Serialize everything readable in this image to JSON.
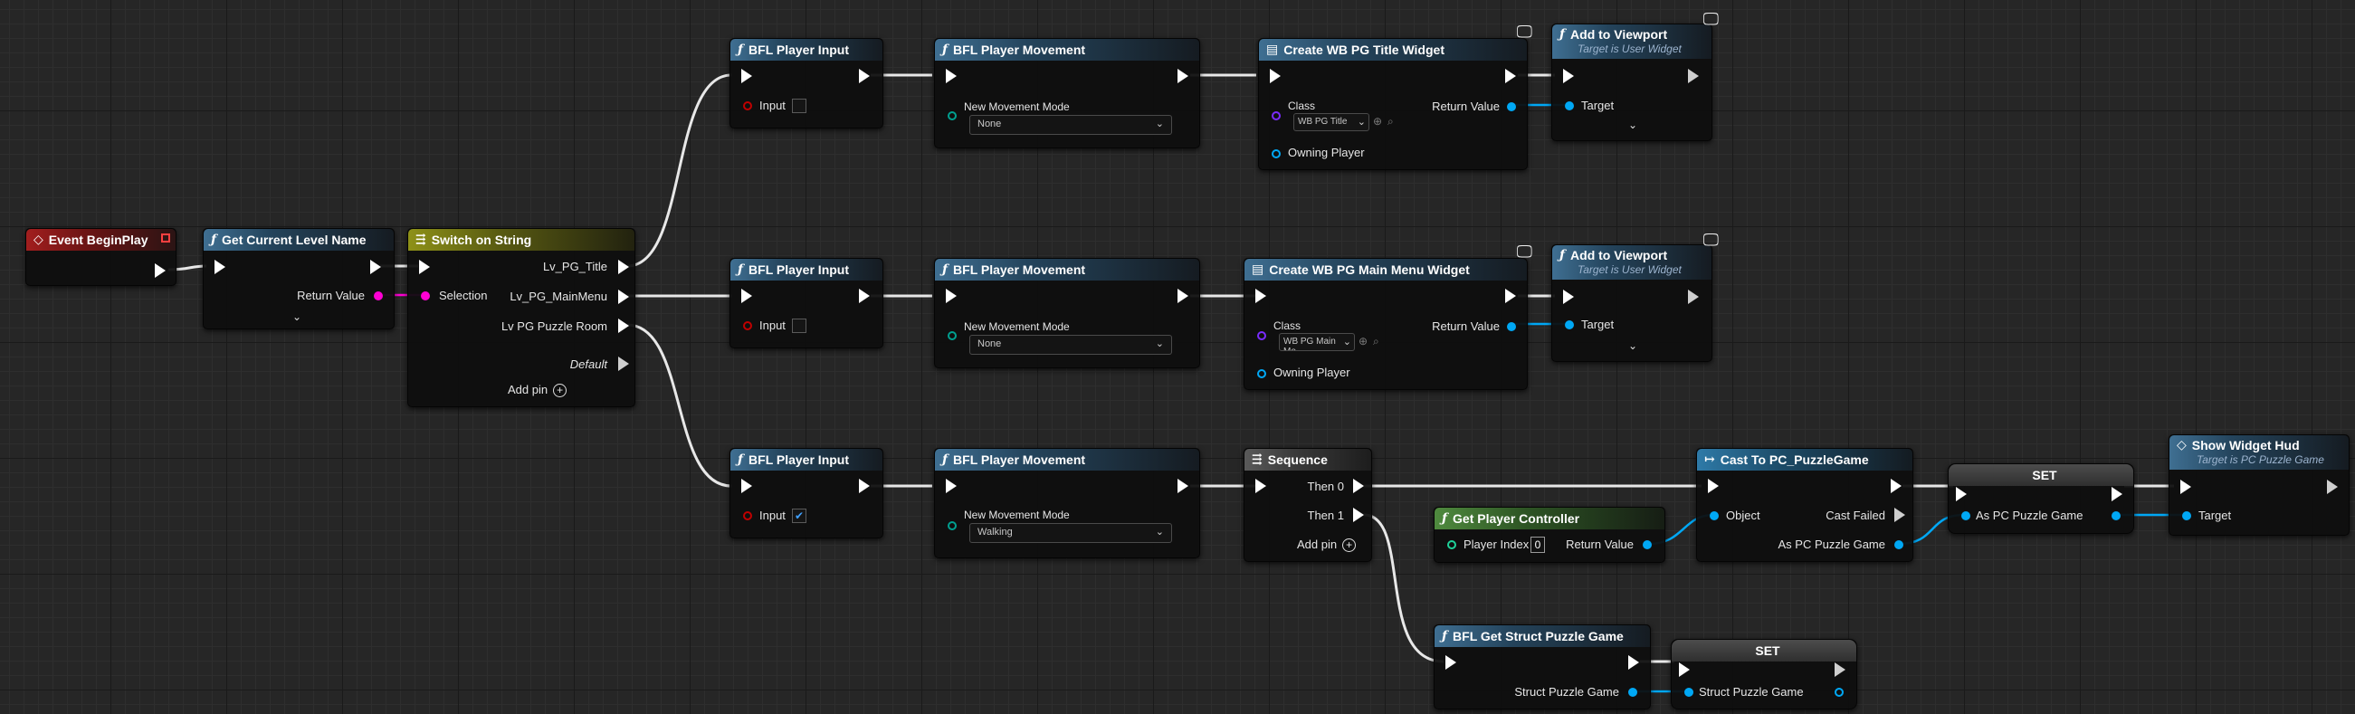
{
  "nodes": {
    "event_begin_play": {
      "title": "Event BeginPlay"
    },
    "get_current_level": {
      "title": "Get Current Level Name",
      "return_label": "Return Value"
    },
    "switch_on_string": {
      "title": "Switch on String",
      "input_label": "Selection",
      "outputs": [
        "Lv_PG_Title",
        "Lv_PG_MainMenu",
        "Lv PG Puzzle Room",
        "Default"
      ],
      "add_pin": "Add pin"
    },
    "row1": {
      "player_input": {
        "title": "BFL Player Input",
        "input_label": "Input",
        "checked": ""
      },
      "player_movement": {
        "title": "BFL Player Movement",
        "mode_label": "New Movement Mode",
        "mode_value": "None"
      },
      "create_widget": {
        "title": "Create WB PG Title Widget",
        "class_label": "Class",
        "class_value": "WB PG Title",
        "return_label": "Return Value",
        "owning_label": "Owning Player"
      },
      "add_viewport": {
        "title": "Add to Viewport",
        "subtitle": "Target is User Widget",
        "target_label": "Target"
      }
    },
    "row2": {
      "player_input": {
        "title": "BFL Player Input",
        "input_label": "Input",
        "checked": ""
      },
      "player_movement": {
        "title": "BFL Player Movement",
        "mode_label": "New Movement Mode",
        "mode_value": "None"
      },
      "create_widget": {
        "title": "Create WB PG Main Menu Widget",
        "class_label": "Class",
        "class_value": "WB PG Main Me",
        "return_label": "Return Value",
        "owning_label": "Owning Player"
      },
      "add_viewport": {
        "title": "Add to Viewport",
        "subtitle": "Target is User Widget",
        "target_label": "Target"
      }
    },
    "row3": {
      "player_input": {
        "title": "BFL Player Input",
        "input_label": "Input",
        "checked": "✔"
      },
      "player_movement": {
        "title": "BFL Player Movement",
        "mode_label": "New Movement Mode",
        "mode_value": "Walking"
      },
      "sequence": {
        "title": "Sequence",
        "outputs": [
          "Then 0",
          "Then 1"
        ],
        "add_pin": "Add pin"
      },
      "get_player_controller": {
        "title": "Get Player Controller",
        "index_label": "Player Index",
        "index_value": "0",
        "return_label": "Return Value"
      },
      "cast": {
        "title": "Cast To PC_PuzzleGame",
        "object_label": "Object",
        "failed_label": "Cast Failed",
        "as_label": "As PC Puzzle Game"
      },
      "set1": {
        "title": "SET",
        "var_label": "As PC Puzzle Game"
      },
      "show_hud": {
        "title": "Show Widget Hud",
        "subtitle": "Target is PC Puzzle Game",
        "target_label": "Target"
      },
      "get_struct": {
        "title": "BFL Get Struct Puzzle Game",
        "out_label": "Struct Puzzle Game"
      },
      "set2": {
        "title": "SET",
        "var_label": "Struct Puzzle Game"
      }
    }
  },
  "colors": {
    "exec": "#ffffff",
    "string": "#ff00d4",
    "object": "#00a8f5",
    "bool": "#940000",
    "enum": "#00685a",
    "class": "#5800bb",
    "wire": "#e8e8e8"
  }
}
